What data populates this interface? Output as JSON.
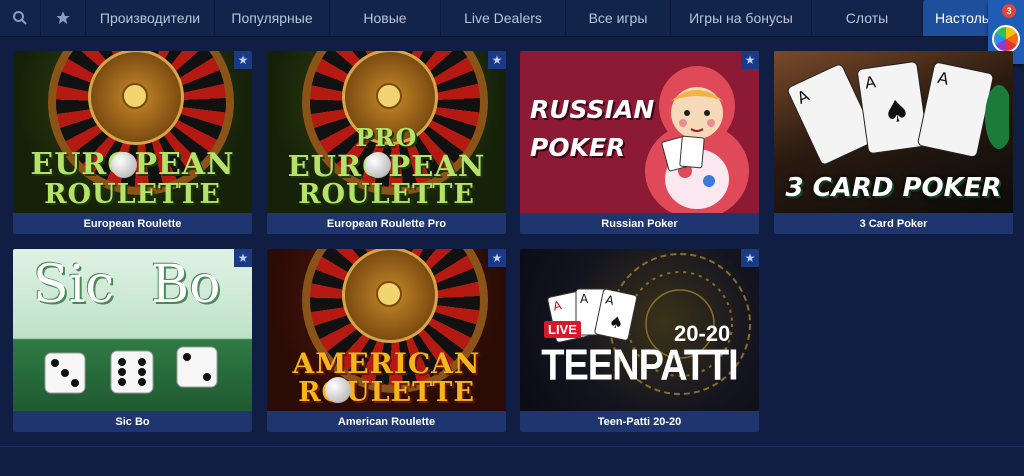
{
  "nav": {
    "search_icon": "search-icon",
    "star_icon": "star-icon",
    "items": [
      "Производители",
      "Популярные",
      "Новые",
      "Live Dealers",
      "Все игры",
      "Игры на бонусы",
      "Слоты",
      "Настольные"
    ],
    "active_index": 7,
    "badge_count": "3"
  },
  "games": [
    {
      "title": "European Roulette",
      "art_lines": [
        "EUROPEAN",
        "ROULETTE"
      ]
    },
    {
      "title": "European Roulette Pro",
      "art_lines": [
        "PRO",
        "EUROPEAN",
        "ROULETTE"
      ]
    },
    {
      "title": "Russian Poker",
      "art_lines": [
        "RUSSIAN",
        "POKER"
      ]
    },
    {
      "title": "3 Card Poker",
      "art_lines": [
        "3 CARD POKER"
      ]
    },
    {
      "title": "Sic Bo",
      "art_lines": [
        "Sic",
        "Bo"
      ]
    },
    {
      "title": "American Roulette",
      "art_lines": [
        "AMERICAN",
        "ROULETTE"
      ]
    },
    {
      "title": "Teen-Patti 20-20",
      "art_lines": [
        "LIVE",
        "20-20",
        "TEENPATTI"
      ]
    }
  ],
  "colors": {
    "background": "#0f1e42",
    "nav": "#13244b",
    "active_tab": "#1d4f9c",
    "card_footer": "#1f3570"
  }
}
